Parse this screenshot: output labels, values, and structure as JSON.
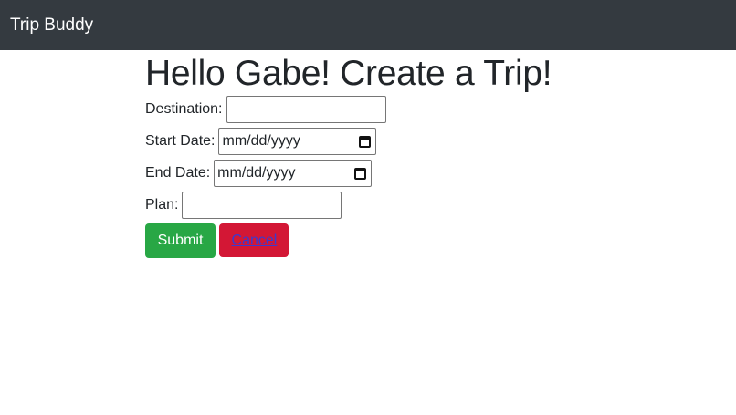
{
  "nav": {
    "brand": "Trip Buddy"
  },
  "page": {
    "title": "Hello Gabe! Create a Trip!"
  },
  "form": {
    "destination": {
      "label": "Destination:",
      "value": ""
    },
    "start_date": {
      "label": "Start Date:",
      "placeholder": "mm/dd/yyyy"
    },
    "end_date": {
      "label": "End Date:",
      "placeholder": "mm/dd/yyyy"
    },
    "plan": {
      "label": "Plan:",
      "value": ""
    },
    "submit_label": "Submit",
    "cancel_label": "Cancel"
  },
  "colors": {
    "navbar": "#343a40",
    "submit": "#28a745",
    "cancel": "#d31735"
  },
  "icons": {
    "date_picker": "calendar-icon"
  }
}
